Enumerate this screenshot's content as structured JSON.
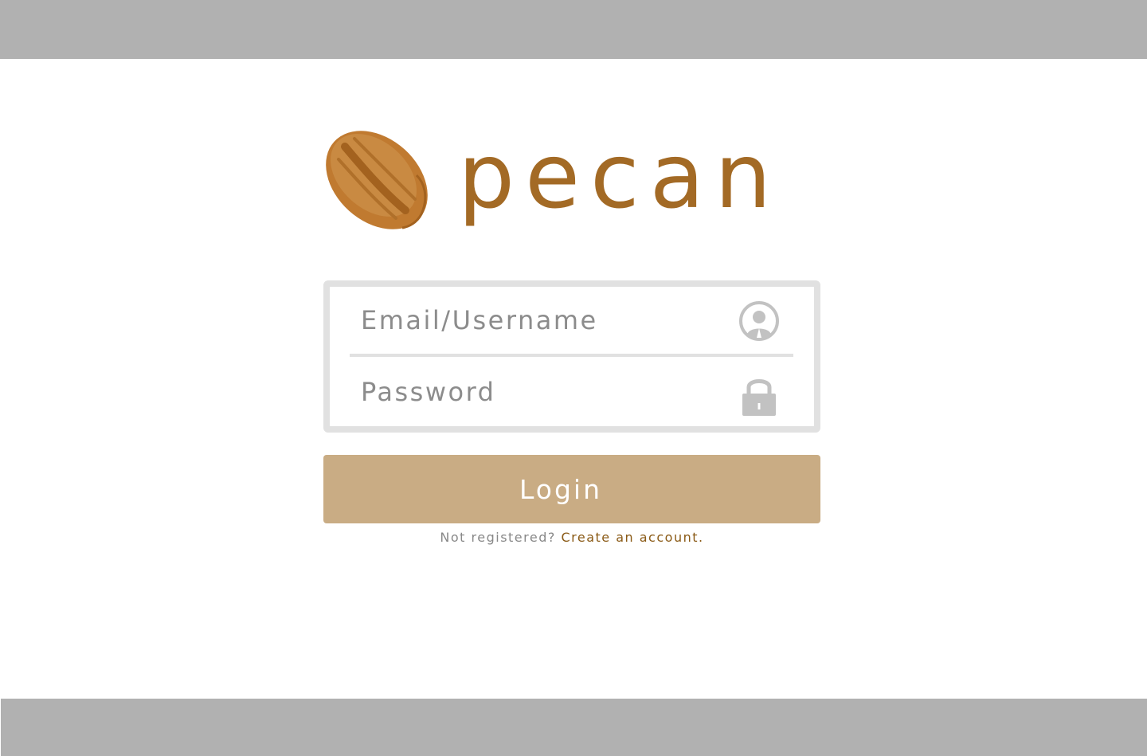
{
  "brand": {
    "name": "pecan",
    "color": "#a36a25",
    "logo_icon": "pecan-nut-icon"
  },
  "login_form": {
    "email_placeholder": "Email/Username",
    "email_value": "",
    "email_icon": "user-icon",
    "password_placeholder": "Password",
    "password_value": "",
    "password_icon": "lock-icon",
    "submit_label": "Login",
    "button_color": "#c9ac84"
  },
  "register": {
    "prompt": "Not registered?",
    "link_label": "Create an account.",
    "link_color": "#8a5a16"
  }
}
